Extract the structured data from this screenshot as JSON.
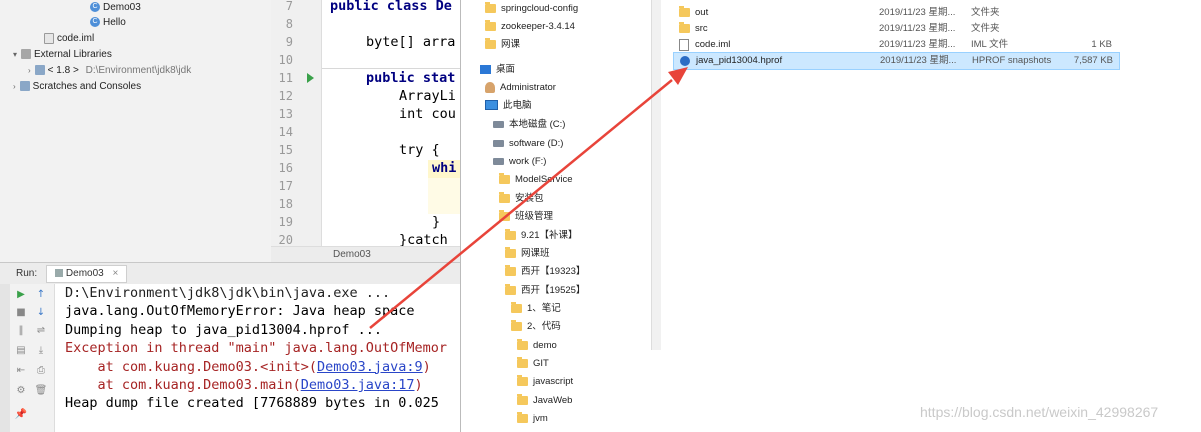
{
  "ide": {
    "tree": [
      {
        "label": "Demo03",
        "kind": "java"
      },
      {
        "label": "Hello",
        "kind": "java"
      },
      {
        "label": "code.iml",
        "kind": "file"
      },
      {
        "label": "External Libraries",
        "kind": "lib"
      },
      {
        "label": "< 1.8 >",
        "path": "D:\\Environment\\jdk8\\jdk",
        "kind": "lib"
      },
      {
        "label": "Scratches and Consoles",
        "kind": "folder"
      }
    ],
    "line_numbers": [
      "7",
      "8",
      "9",
      "10",
      "11",
      "12",
      "13",
      "14",
      "15",
      "16",
      "17",
      "18",
      "19",
      "20"
    ],
    "code": {
      "l7": "public class De",
      "l9": "byte[] arra",
      "l11": "public stat",
      "l12": "ArrayLi",
      "l13": "int cou",
      "l15": "try {",
      "l16": "whi",
      "l19": "}",
      "l20": "}catch"
    },
    "editor_tab": "Demo03",
    "run": {
      "label": "Run:",
      "tab": "Demo03",
      "console": [
        "D:\\Environment\\jdk8\\jdk\\bin\\java.exe ...",
        "java.lang.OutOfMemoryError: Java heap space",
        "Dumping heap to java_pid13004.hprof ...",
        "Exception in thread \"main\" java.lang.OutOfMemor",
        "    at com.kuang.Demo03.<init>(",
        "Demo03.java:9",
        ")",
        "    at com.kuang.Demo03.main(",
        "Demo03.java:17",
        ")",
        "Heap dump file created [7768889 bytes in 0.025"
      ]
    }
  },
  "explorer": {
    "nav": [
      "springcloud-config",
      "zookeeper-3.4.14",
      "网课",
      "桌面",
      "Administrator",
      "此电脑",
      "本地磁盘 (C:)",
      "software (D:)",
      "work (F:)",
      "ModelService",
      "安装包",
      "班级管理",
      "9.21【补课】",
      "网课班",
      "西开【19323】",
      "西开【19525】",
      "1、笔记",
      "2、代码",
      "demo",
      "GIT",
      "javascript",
      "JavaWeb",
      "jvm"
    ],
    "files": [
      {
        "name": "out",
        "date": "2019/11/23 星期...",
        "type": "文件夹",
        "size": ""
      },
      {
        "name": "src",
        "date": "2019/11/23 星期...",
        "type": "文件夹",
        "size": ""
      },
      {
        "name": "code.iml",
        "date": "2019/11/23 星期...",
        "type": "IML 文件",
        "size": "1 KB"
      },
      {
        "name": "java_pid13004.hprof",
        "date": "2019/11/23 星期...",
        "type": "HPROF snapshots",
        "size": "7,587 KB"
      }
    ]
  },
  "watermark": "https://blog.csdn.net/weixin_42998267",
  "colors": {
    "arrow": "#e8443a",
    "selection": "#cce8ff",
    "error_text": "#a62424",
    "link": "#2a46c8"
  }
}
